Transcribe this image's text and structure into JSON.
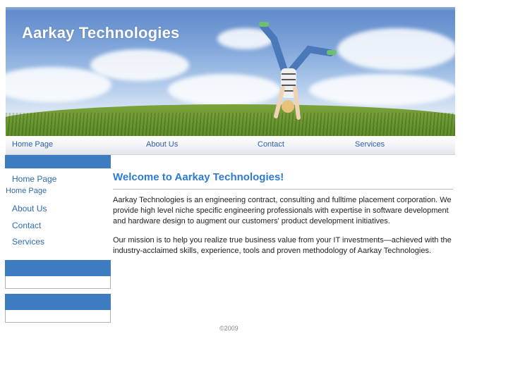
{
  "site": {
    "title": "Aarkay Technologies"
  },
  "topnav": {
    "items": [
      {
        "label": "Home Page"
      },
      {
        "label": "About Us"
      },
      {
        "label": "Contact"
      },
      {
        "label": "Services"
      }
    ]
  },
  "sidebar": {
    "items": [
      {
        "label": "Home Page"
      },
      {
        "label": "Home Page"
      },
      {
        "label": "About Us"
      },
      {
        "label": "Contact"
      },
      {
        "label": "Services"
      }
    ]
  },
  "main": {
    "heading": "Welcome to Aarkay Technologies!",
    "paragraphs": [
      "Aarkay Technologies is an engineering contract, consulting and fulltime placement corporation. We provide high level niche specific engineering professionals with expertise in software development and hardware design to augment our customers' product development initiatives.",
      "Our mission is to help you realize true business value from your IT investments—achieved with the industry-acclaimed skills, experience, tools and proven methodology of Aarkay Technologies."
    ]
  },
  "footer": {
    "copyright": "©2009"
  },
  "colors": {
    "accent_blue": "#3d7cc0",
    "link_blue": "#2e6bb3",
    "heading_blue": "#2e7bd0"
  }
}
